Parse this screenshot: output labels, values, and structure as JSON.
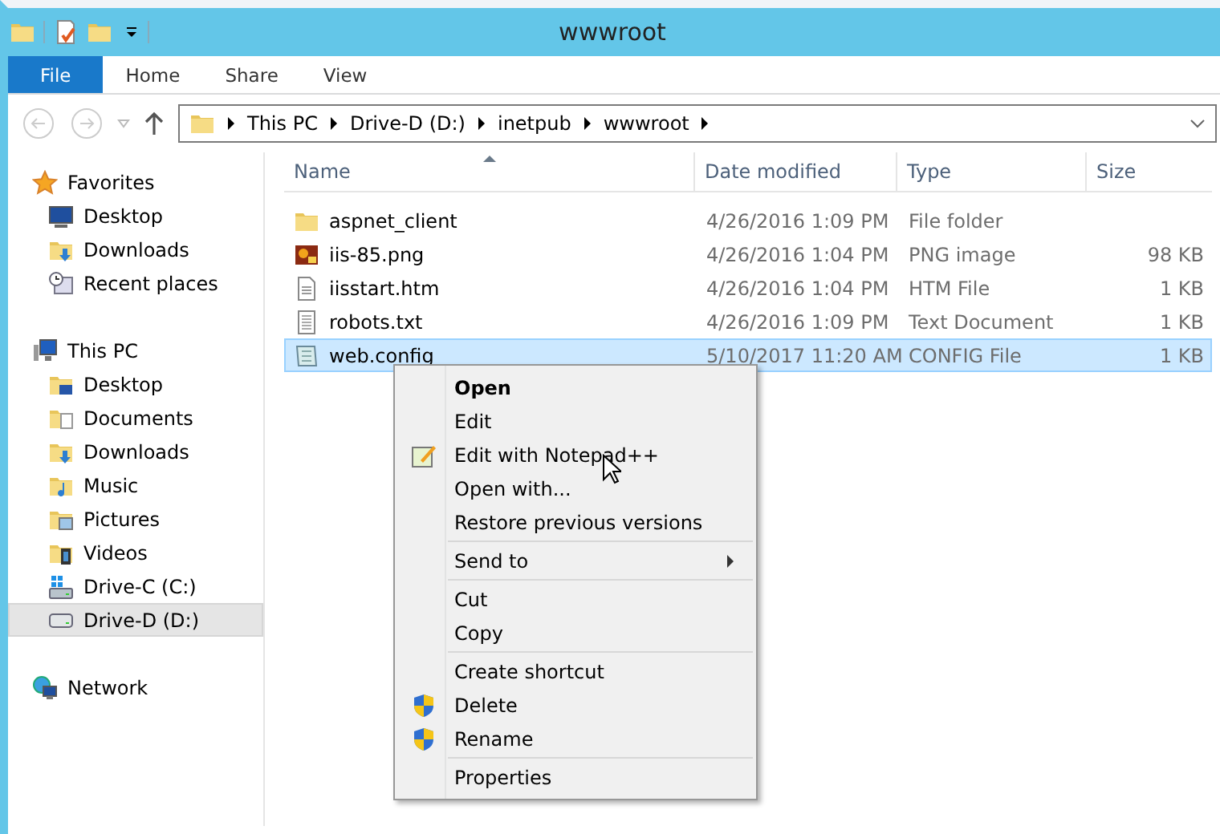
{
  "window": {
    "title": "wwwroot"
  },
  "ribbon_tabs": [
    {
      "label": "File",
      "selected": true
    },
    {
      "label": "Home",
      "selected": false
    },
    {
      "label": "Share",
      "selected": false
    },
    {
      "label": "View",
      "selected": false
    }
  ],
  "breadcrumb": [
    "This PC",
    "Drive-D (D:)",
    "inetpub",
    "wwwroot"
  ],
  "sidebar": [
    {
      "label": "Favorites",
      "kind": "star",
      "selected": false,
      "children": [
        {
          "label": "Desktop",
          "kind": "monitor",
          "selected": false
        },
        {
          "label": "Downloads",
          "kind": "downloads",
          "selected": false
        },
        {
          "label": "Recent places",
          "kind": "recent",
          "selected": false
        }
      ]
    },
    {
      "label": "This PC",
      "kind": "pc",
      "selected": false,
      "children": [
        {
          "label": "Desktop",
          "kind": "desktop-folder",
          "selected": false
        },
        {
          "label": "Documents",
          "kind": "documents",
          "selected": false
        },
        {
          "label": "Downloads",
          "kind": "downloads",
          "selected": false
        },
        {
          "label": "Music",
          "kind": "music",
          "selected": false
        },
        {
          "label": "Pictures",
          "kind": "pictures",
          "selected": false
        },
        {
          "label": "Videos",
          "kind": "videos",
          "selected": false
        },
        {
          "label": "Drive-C (C:)",
          "kind": "system-drive",
          "selected": false
        },
        {
          "label": "Drive-D (D:)",
          "kind": "drive",
          "selected": true
        }
      ]
    },
    {
      "label": "Network",
      "kind": "network",
      "selected": false
    }
  ],
  "table": {
    "columns": [
      "Name",
      "Date modified",
      "Type",
      "Size"
    ],
    "rows": [
      {
        "name": "aspnet_client",
        "date": "4/26/2016 1:09 PM",
        "type": "File folder",
        "kind": "folder",
        "selected": false
      },
      {
        "name": "iis-85.png",
        "date": "4/26/2016 1:04 PM",
        "type": "PNG image",
        "size": "98 KB",
        "kind": "image",
        "selected": false
      },
      {
        "name": "iisstart.htm",
        "date": "4/26/2016 1:04 PM",
        "type": "HTM File",
        "size": "1 KB",
        "kind": "document",
        "selected": false
      },
      {
        "name": "robots.txt",
        "date": "4/26/2016 1:09 PM",
        "type": "Text Document",
        "size": "1 KB",
        "kind": "text",
        "selected": false
      },
      {
        "name": "web.config",
        "date": "5/10/2017 11:20 AM",
        "type": "CONFIG File",
        "size": "1 KB",
        "kind": "config",
        "selected": true
      }
    ]
  },
  "context_menu": [
    [
      {
        "label": "Open",
        "default": true
      },
      {
        "label": "Edit"
      },
      {
        "label": "Edit with Notepad++",
        "kind": "notepad"
      },
      {
        "label": "Open with..."
      },
      {
        "label": "Restore previous versions"
      }
    ],
    [
      {
        "label": "Send to",
        "submenu": true
      }
    ],
    [
      {
        "label": "Cut"
      },
      {
        "label": "Copy"
      }
    ],
    [
      {
        "label": "Create shortcut"
      },
      {
        "label": "Delete",
        "kind": "shield"
      },
      {
        "label": "Rename",
        "kind": "shield"
      }
    ],
    [
      {
        "label": "Properties"
      }
    ]
  ]
}
